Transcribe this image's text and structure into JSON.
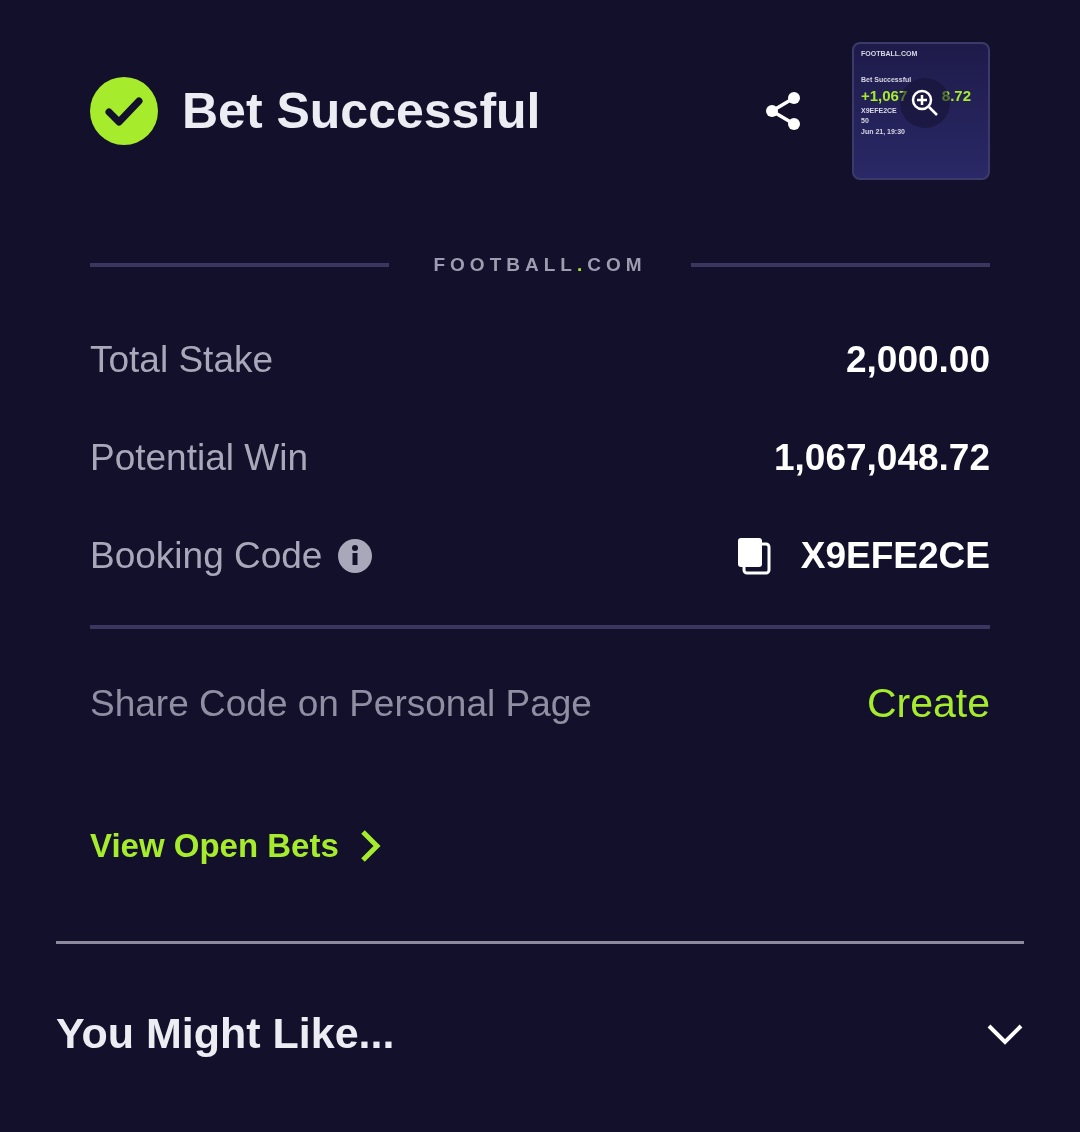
{
  "header": {
    "title": "Bet Successful"
  },
  "preview": {
    "logo": {
      "name": "FOOTBALL",
      "dot": ".",
      "suffix": "COM"
    },
    "title": "Bet Successful",
    "amount": [
      "+1,067",
      "8.72"
    ],
    "code": "X9EFE2CE",
    "stake": "50",
    "date": "Jun 21, 19:30"
  },
  "brand": {
    "name": "FOOTBALL",
    "dot": ".",
    "suffix": "COM"
  },
  "summary": [
    {
      "label": "Total Stake",
      "value": "2,000.00",
      "kind": "plain"
    },
    {
      "label": "Potential Win",
      "value": "1,067,048.72",
      "kind": "plain"
    },
    {
      "label": "Booking Code",
      "value": "X9EFE2CE",
      "kind": "code"
    }
  ],
  "share": {
    "label": "Share Code on Personal Page",
    "action": "Create"
  },
  "open_bets": {
    "label": "View Open Bets"
  },
  "suggestions": {
    "title": "You Might Like...",
    "expanded": false
  }
}
